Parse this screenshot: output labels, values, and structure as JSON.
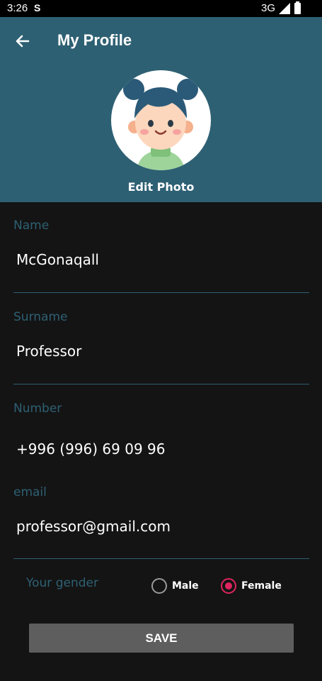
{
  "status_bar": {
    "time": "3:26",
    "app_icon_letter": "S",
    "network": "3G"
  },
  "header": {
    "title": "My Profile",
    "back_icon": "arrow-left-icon",
    "edit_photo_label": "Edit Photo",
    "background_color": "#2e6073"
  },
  "form": {
    "name": {
      "label": "Name",
      "value": "McGonaqall"
    },
    "surname": {
      "label": "Surname",
      "value": "Professor"
    },
    "number": {
      "label": "Number",
      "value": "+996 (996) 69 09 96"
    },
    "email": {
      "label": "email",
      "value": "professor@gmail.com"
    },
    "gender": {
      "label": "Your gender",
      "options": [
        {
          "label": "Male",
          "selected": false
        },
        {
          "label": "Female",
          "selected": true
        }
      ],
      "accent_color": "#e0245e"
    }
  },
  "save_label": "SAVE"
}
